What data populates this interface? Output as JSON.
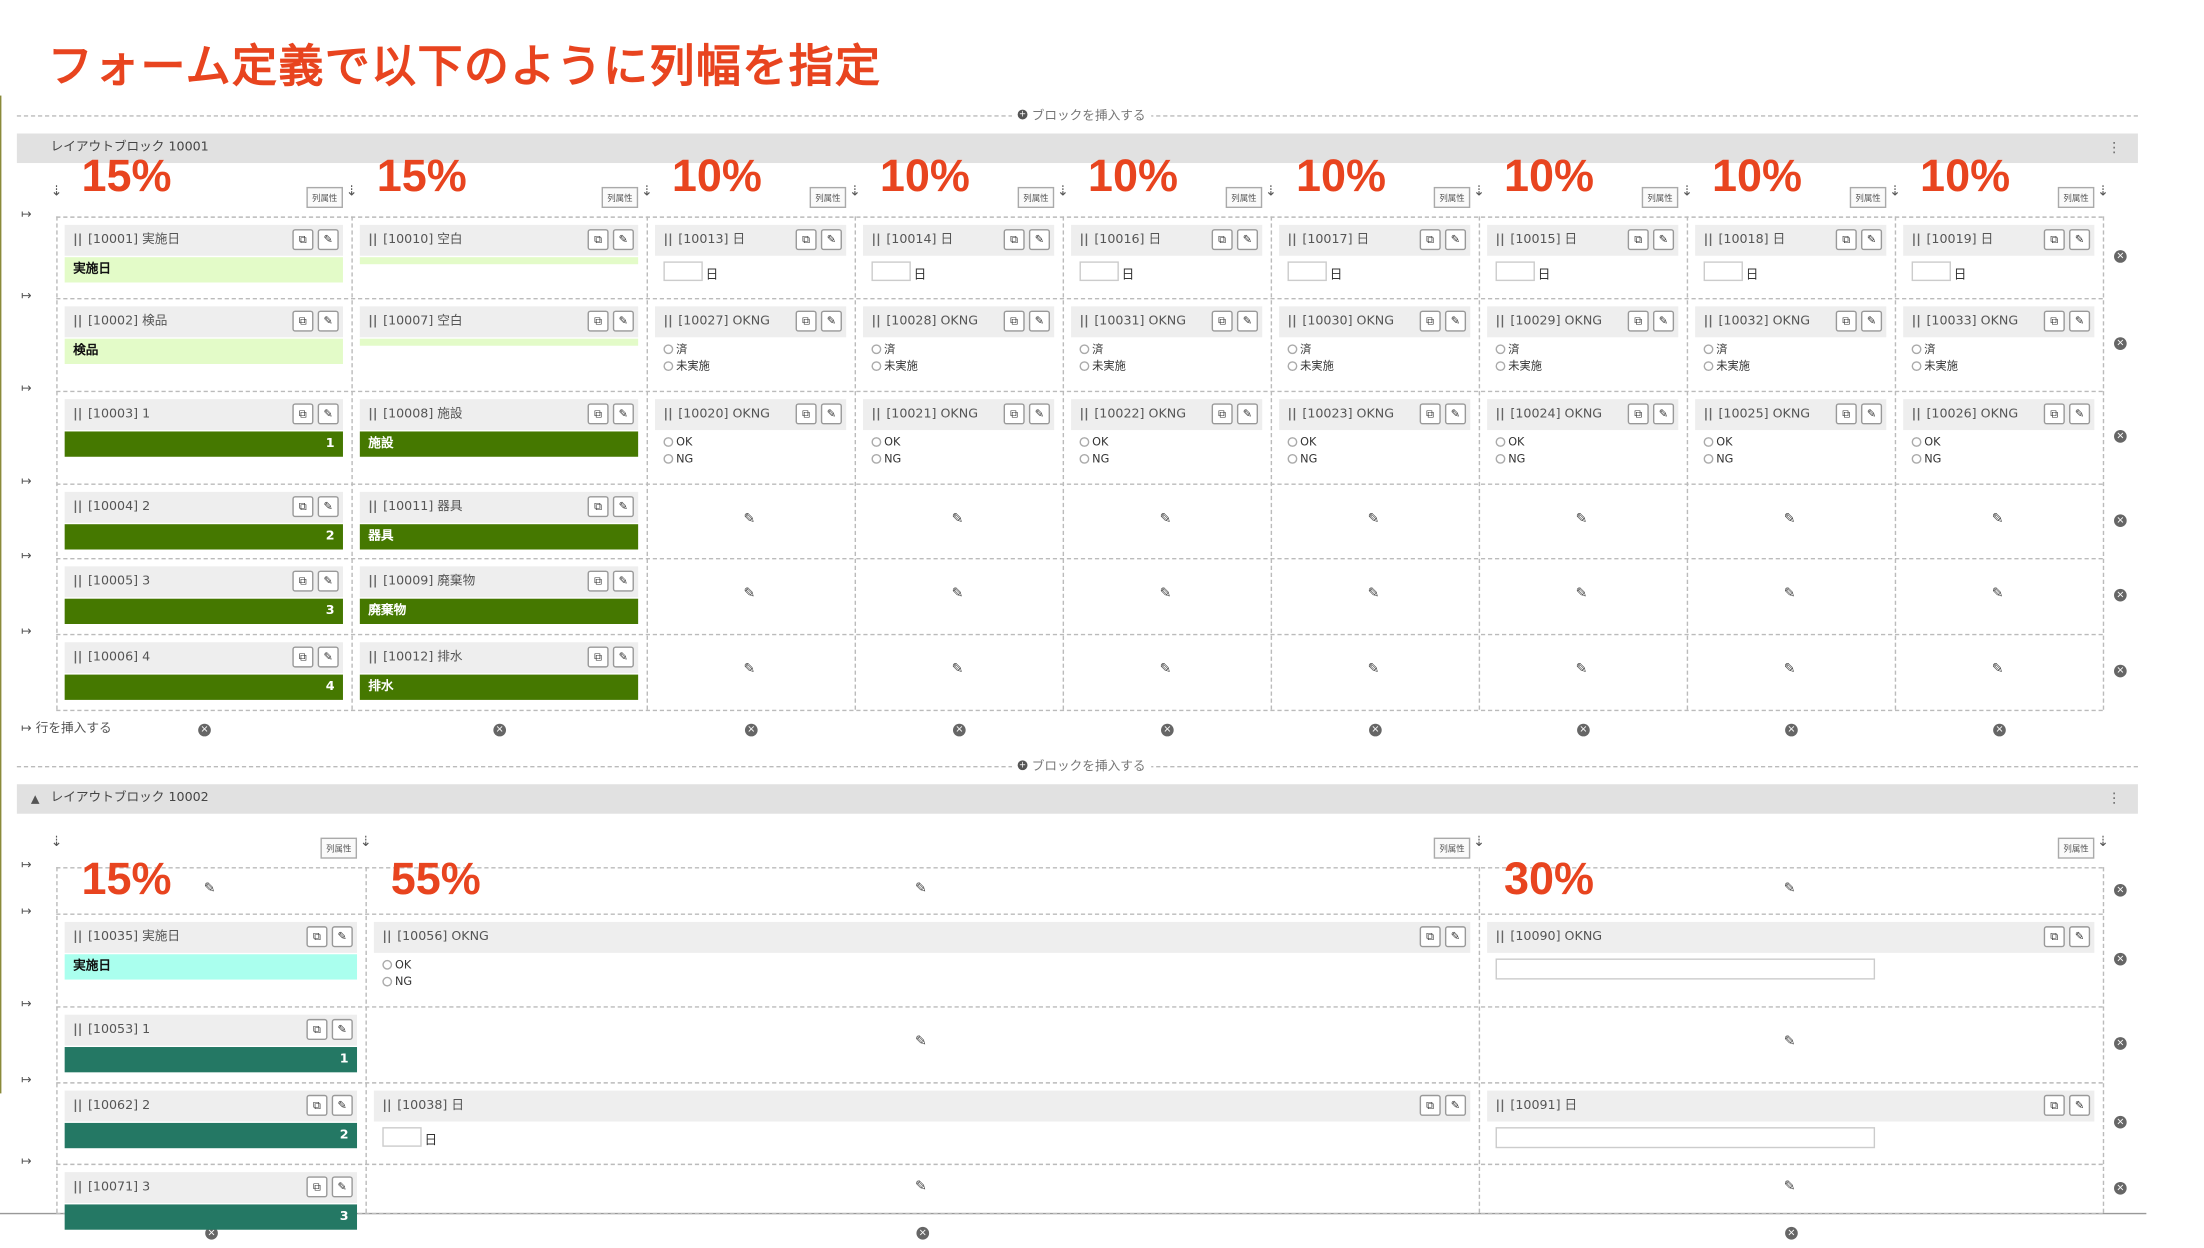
{
  "title": "フォーム定義で以下のように列幅を指定",
  "insert_block_label": "ブロックを挿入する",
  "insert_row_label": "行を挿入する",
  "col_attr_label": "列属性",
  "blocks": [
    {
      "name": "レイアウトブロック 10001"
    },
    {
      "name": "レイアウトブロック 10002"
    }
  ],
  "block1_widths": [
    "15%",
    "15%",
    "10%",
    "10%",
    "10%",
    "10%",
    "10%",
    "10%",
    "10%"
  ],
  "block2_widths": [
    "15%",
    "55%",
    "30%"
  ],
  "radio_options": {
    "done": "済",
    "not_done": "未実施",
    "ok": "OK",
    "ng": "NG"
  },
  "day_label": "日",
  "block1_rows": [
    [
      {
        "id": "[10001] 実施日",
        "bar": "実施日",
        "style": "lg"
      },
      {
        "id": "[10010] 空白",
        "bar": "",
        "style": "thin"
      },
      {
        "id": "[10013] 日",
        "kind": "date"
      },
      {
        "id": "[10014] 日",
        "kind": "date"
      },
      {
        "id": "[10016] 日",
        "kind": "date"
      },
      {
        "id": "[10017] 日",
        "kind": "date"
      },
      {
        "id": "[10015] 日",
        "kind": "date"
      },
      {
        "id": "[10018] 日",
        "kind": "date"
      },
      {
        "id": "[10019] 日",
        "kind": "date"
      }
    ],
    [
      {
        "id": "[10002] 検品",
        "bar": "検品",
        "style": "lg"
      },
      {
        "id": "[10007] 空白",
        "bar": "",
        "style": "thin"
      },
      {
        "id": "[10027] OKNG",
        "kind": "done"
      },
      {
        "id": "[10028] OKNG",
        "kind": "done"
      },
      {
        "id": "[10031] OKNG",
        "kind": "done"
      },
      {
        "id": "[10030] OKNG",
        "kind": "done"
      },
      {
        "id": "[10029] OKNG",
        "kind": "done"
      },
      {
        "id": "[10032] OKNG",
        "kind": "done"
      },
      {
        "id": "[10033] OKNG",
        "kind": "done"
      }
    ],
    [
      {
        "id": "[10003] 1",
        "bar": "1",
        "style": "dg",
        "align": "r"
      },
      {
        "id": "[10008] 施設",
        "bar": "施設",
        "style": "dg"
      },
      {
        "id": "[10020] OKNG",
        "kind": "okng"
      },
      {
        "id": "[10021] OKNG",
        "kind": "okng"
      },
      {
        "id": "[10022] OKNG",
        "kind": "okng"
      },
      {
        "id": "[10023] OKNG",
        "kind": "okng"
      },
      {
        "id": "[10024] OKNG",
        "kind": "okng"
      },
      {
        "id": "[10025] OKNG",
        "kind": "okng"
      },
      {
        "id": "[10026] OKNG",
        "kind": "okng"
      }
    ],
    [
      {
        "id": "[10004] 2",
        "bar": "2",
        "style": "dg",
        "align": "r"
      },
      {
        "id": "[10011] 器具",
        "bar": "器具",
        "style": "dg"
      }
    ],
    [
      {
        "id": "[10005] 3",
        "bar": "3",
        "style": "dg",
        "align": "r"
      },
      {
        "id": "[10009] 廃棄物",
        "bar": "廃棄物",
        "style": "dg"
      }
    ],
    [
      {
        "id": "[10006] 4",
        "bar": "4",
        "style": "dg",
        "align": "r"
      },
      {
        "id": "[10012] 排水",
        "bar": "排水",
        "style": "dg"
      }
    ]
  ],
  "block2_rows": [
    [
      {
        "id": "[10035] 実施日",
        "bar": "実施日",
        "style": "cy"
      },
      {
        "id": "[10056] OKNG",
        "kind": "okng"
      },
      {
        "id": "[10090] OKNG",
        "kind": "text"
      }
    ],
    [
      {
        "id": "[10053] 1",
        "bar": "1",
        "style": "tl",
        "align": "r"
      }
    ],
    [
      {
        "id": "[10062] 2",
        "bar": "2",
        "style": "tl",
        "align": "r"
      },
      {
        "id": "[10038] 日",
        "kind": "date"
      },
      {
        "id": "[10091] 日",
        "kind": "text"
      }
    ],
    [
      {
        "id": "[10071] 3",
        "bar": "3",
        "style": "tl",
        "align": "r"
      }
    ]
  ]
}
